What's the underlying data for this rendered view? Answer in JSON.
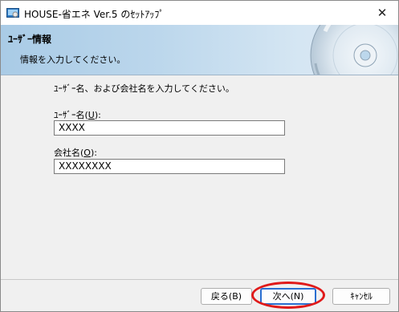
{
  "window": {
    "title": "HOUSE-省エネ Ver.5 のｾｯﾄｱｯﾌﾟ",
    "close_glyph": "✕"
  },
  "banner": {
    "title": "ﾕｰｻﾞｰ情報",
    "subtitle": "情報を入力してください。"
  },
  "form": {
    "instruction": "ﾕｰｻﾞｰ名、および会社名を入力してください。",
    "user_label_prefix": "ﾕｰｻﾞｰ名(",
    "user_label_key": "U",
    "user_label_suffix": "):",
    "user_value": "XXXX",
    "company_label_prefix": "会社名(",
    "company_label_key": "O",
    "company_label_suffix": "):",
    "company_value": "XXXXXXXX"
  },
  "buttons": {
    "back": "戻る(B)",
    "next": "次へ(N)",
    "cancel": "ｷｬﾝｾﾙ"
  },
  "colors": {
    "highlight": "#e01a1a",
    "focus_border": "#2a6fd1"
  }
}
